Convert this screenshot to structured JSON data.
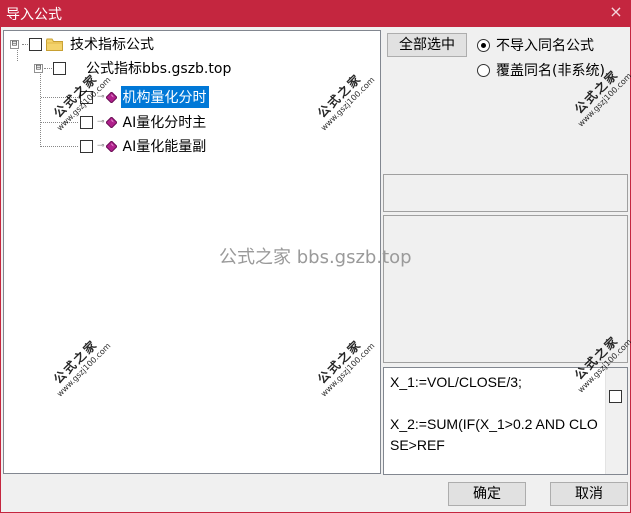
{
  "window": {
    "title": "导入公式",
    "close_glyph": "×"
  },
  "tree": {
    "root": {
      "expander": "⊟",
      "label": "技术指标公式"
    },
    "group": {
      "expander": "⊟",
      "label": "公式指标bbs.gszb.top"
    },
    "items": [
      {
        "label": "机构量化分时",
        "selected": true
      },
      {
        "label": "AI量化分时主",
        "selected": false
      },
      {
        "label": "AI量化能量副",
        "selected": false
      }
    ]
  },
  "options": {
    "select_all_label": "全部选中",
    "radio_skip_label": "不导入同名公式",
    "radio_overwrite_label": "覆盖同名(非系统)"
  },
  "code": {
    "text": "X_1:=VOL/CLOSE/3;\n\nX_2:=SUM(IF(X_1>0.2 AND CLOSE>REF"
  },
  "buttons": {
    "ok_label": "确定",
    "cancel_label": "取消"
  },
  "watermark": {
    "center_text": "公式之家 bbs.gszb.top",
    "stamp_cn": "公式之家",
    "stamp_url": "www.gszj100.com"
  },
  "colors": {
    "titlebar": "#c4263f",
    "selection": "#0078d7",
    "item_icon": "#b0208c"
  }
}
